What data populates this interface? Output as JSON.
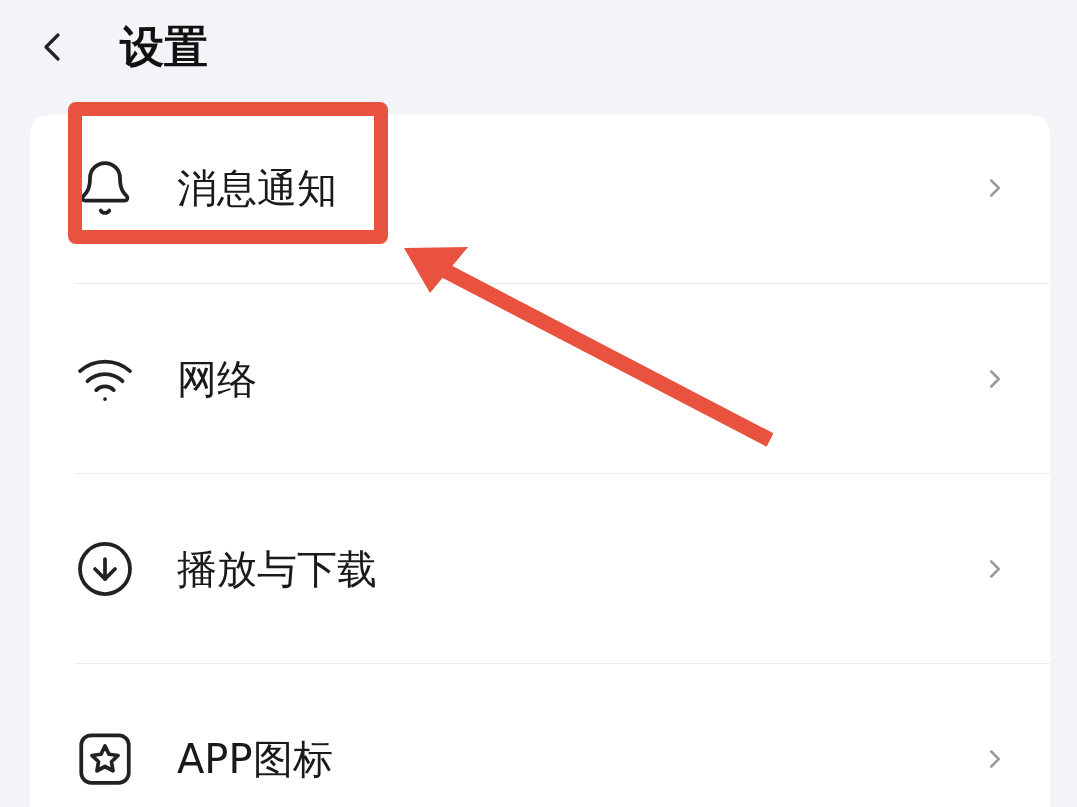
{
  "header": {
    "title": "设置"
  },
  "items": [
    {
      "label": "消息通知",
      "highlighted": true
    },
    {
      "label": "网络",
      "highlighted": false
    },
    {
      "label": "播放与下载",
      "highlighted": false
    },
    {
      "label": "APP图标",
      "highlighted": false
    }
  ]
}
